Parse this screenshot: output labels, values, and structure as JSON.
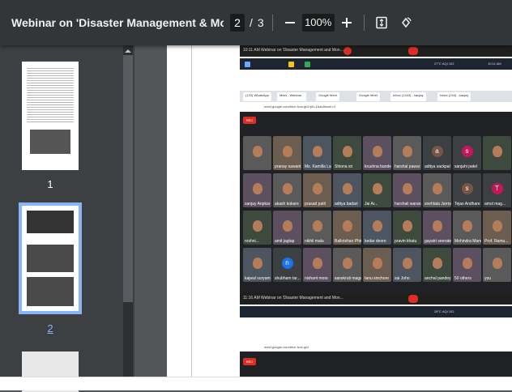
{
  "toolbar": {
    "title": "Webinar on 'Disaster Management & Monsoon Preaparedness'....",
    "current_page": "2",
    "page_separator": "/",
    "total_pages": "3",
    "zoom_out_icon": "minus-icon",
    "zoom": "100%",
    "zoom_in_icon": "plus-icon",
    "fit_icon": "fit-page-icon",
    "rotate_icon": "rotate-icon"
  },
  "sidebar": {
    "thumbnails": [
      {
        "label": "1"
      },
      {
        "label": "2"
      }
    ]
  },
  "screenshot_top": {
    "taskbar_time": "10:11 AM",
    "taskbar_title": "Webinar on 'Disaster Management and Mon...",
    "weather": "27°C AQI 102",
    "clock": "10:11 AM"
  },
  "browser": {
    "tabs": [
      "(133) WhatsApp",
      "Meet - Webinar - ",
      "Google Meet",
      "Google Meet",
      "Inbox (1343) - sanjay",
      "Inbox (244) - sanjay"
    ],
    "url": "meet.google.com/btcn-fcxs-gtd?pli=1&authuser=2",
    "rec": "REC"
  },
  "participants": [
    "",
    "pranay sawant",
    "Ms. Kamilla La...",
    "Shiona sri",
    "krushna bande",
    "harshal pawar",
    "aditya sackpal",
    "sanjahi patel",
    "",
    "sanjay Anpkar",
    "akash kokare",
    "prasad patil",
    "aditya badari",
    "Jai Ar...",
    "harshali waran...",
    "snehlata Jarma...",
    "Tejas Andhare",
    "amol mag...",
    "roshni...",
    "amit jagtap",
    "nikhil malu",
    "Balkrishan Phir...",
    "kedar deore",
    "pravin khatu",
    "gayatri seerate...",
    "Mohindra Mane",
    "Prof. Ramu...",
    "kajwal suryam",
    "shubham tar...",
    "nishant more",
    "sanskruti magar",
    "tanu sinchore",
    "sai John",
    "anchal pandey",
    "50 others",
    "you"
  ],
  "screenshot_bottom": {
    "taskbar_time": "11:16 AM",
    "taskbar_title": "Webinar on 'Disaster Management and Mon...",
    "weather": "28°C AQI 102",
    "url": "meet.google.com/btcn-fcxs-gtd",
    "rec": "REC"
  }
}
